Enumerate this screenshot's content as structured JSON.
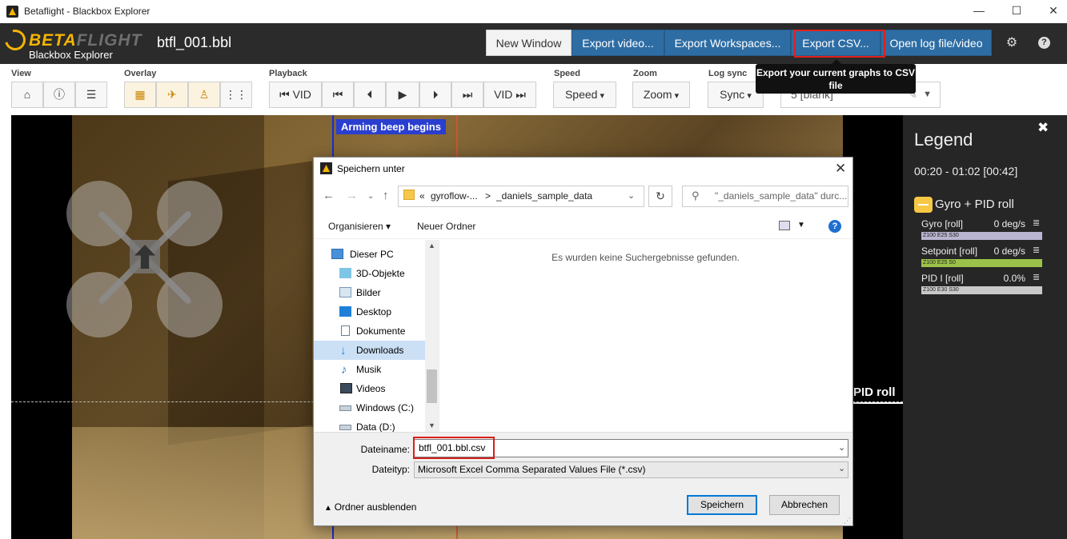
{
  "window": {
    "title": "Betaflight - Blackbox Explorer",
    "controls": [
      "—",
      "☐",
      "✕"
    ]
  },
  "header": {
    "logo_beta": "BETA",
    "logo_flight": "FLIGHT",
    "logo_sub": "Blackbox Explorer",
    "log_file": "btfl_001.bbl",
    "buttons": {
      "new_window": "New Window",
      "export_video": "Export video...",
      "export_workspaces": "Export Workspaces...",
      "export_csv": "Export CSV...",
      "open_log": "Open log file/video"
    },
    "icons": [
      "gear-icon",
      "help-icon"
    ]
  },
  "tooltip": {
    "text": "Export your current graphs to CSV file"
  },
  "toolbar": {
    "view_label": "View",
    "overlay_label": "Overlay",
    "playback_label": "Playback",
    "speed_label": "Speed",
    "zoom_label": "Zoom",
    "logsync_label": "Log sync",
    "view_icons": [
      "home-icon",
      "info-icon",
      "list-icon"
    ],
    "overlay_icons": [
      "film-icon",
      "airplane-icon",
      "person-icon",
      "bars-icon"
    ],
    "playback": {
      "vid_back": "⏮ VID",
      "first": "⏮",
      "prev": "⏴",
      "play": "▶",
      "next": "⏵",
      "last": "⏭",
      "vid_fwd": "VID ⏭"
    },
    "speed_btn": "Speed",
    "zoom_btn": "Zoom",
    "sync_btn": "Sync",
    "logsync_value": "5 [blank]"
  },
  "stage": {
    "arming_label": "Arming beep begins",
    "pid_roll_label": "PID roll"
  },
  "legend": {
    "title": "Legend",
    "range": "00:20 - 01:02 [00:42]",
    "group": "Gyro + PID roll",
    "items": [
      {
        "name": "Gyro [roll]",
        "value": "0 deg/s",
        "bar": "Z100 E25 S30",
        "color": "#b9b4cf"
      },
      {
        "name": "Setpoint [roll]",
        "value": "0 deg/s",
        "bar": "Z100 E25 S0",
        "color": "#9cc14a"
      },
      {
        "name": "PID I [roll]",
        "value": "0.0%",
        "bar": "Z100 E30 S30",
        "color": "#c9c9c9"
      }
    ]
  },
  "dialog": {
    "title": "Speichern unter",
    "address": {
      "prefix": "«",
      "path1": "gyroflow-...",
      "sep": ">",
      "path2": "_daniels_sample_data"
    },
    "search_placeholder": "\"_daniels_sample_data\" durc...",
    "organize": "Organisieren ▾",
    "new_folder": "Neuer Ordner",
    "nav_items": [
      {
        "label": "Dieser PC",
        "icon": "pc-icon"
      },
      {
        "label": "3D-Objekte",
        "icon": "cube-icon"
      },
      {
        "label": "Bilder",
        "icon": "pictures-icon"
      },
      {
        "label": "Desktop",
        "icon": "desktop-icon"
      },
      {
        "label": "Dokumente",
        "icon": "document-icon"
      },
      {
        "label": "Downloads",
        "icon": "download-icon"
      },
      {
        "label": "Musik",
        "icon": "music-icon"
      },
      {
        "label": "Videos",
        "icon": "video-icon"
      },
      {
        "label": "Windows (C:)",
        "icon": "drive-icon"
      },
      {
        "label": "Data (D:)",
        "icon": "drive-icon"
      }
    ],
    "empty_message": "Es wurden keine Suchergebnisse gefunden.",
    "filename_label": "Dateiname:",
    "filename_value": "btfl_001.bbl.csv",
    "filetype_label": "Dateityp:",
    "filetype_value": "Microsoft Excel Comma Separated Values File (*.csv)",
    "hide_folders": "Ordner ausblenden",
    "save": "Speichern",
    "cancel": "Abbrechen"
  }
}
